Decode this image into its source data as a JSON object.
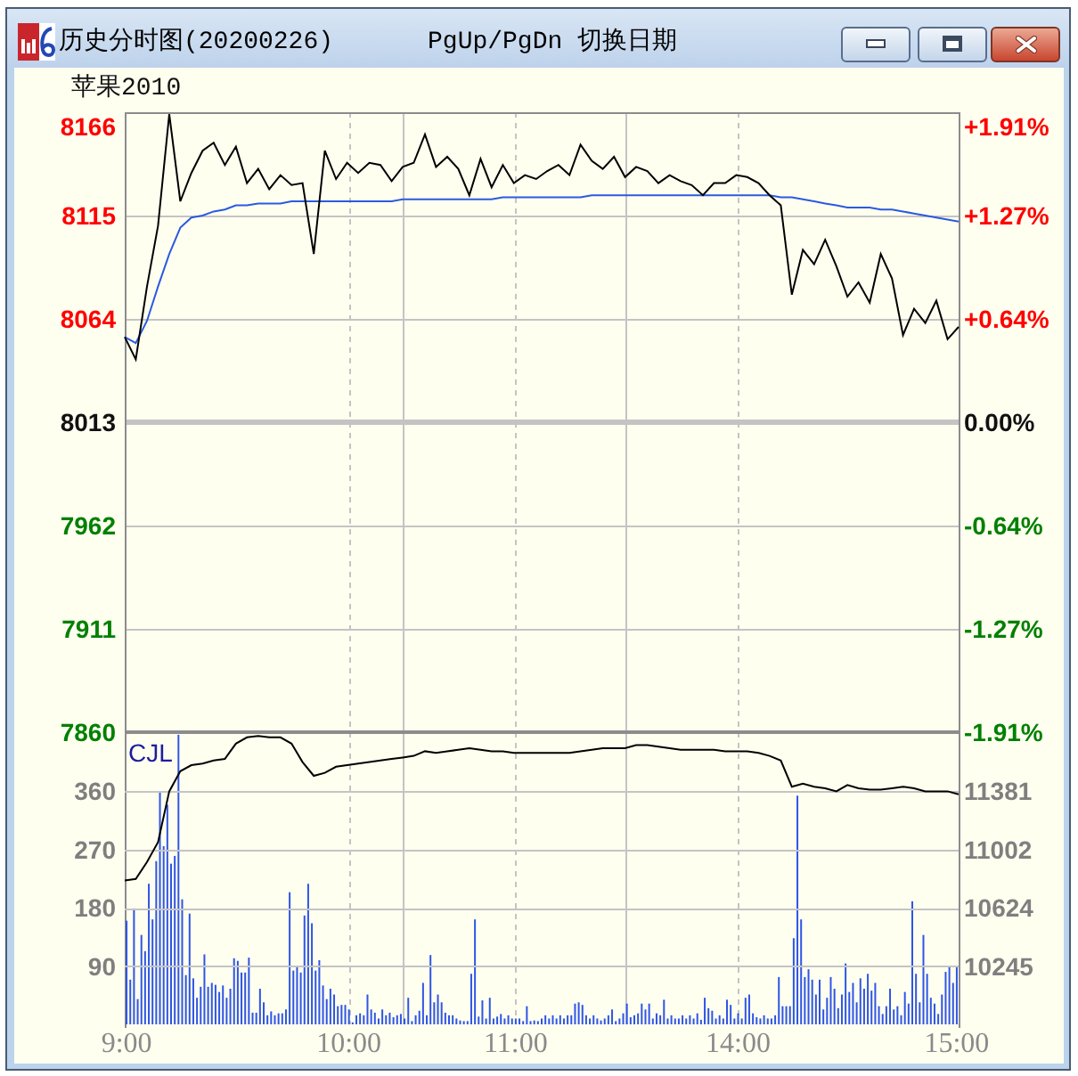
{
  "window": {
    "title": "历史分时图(20200226)",
    "shortcut_hint": "PgUp/PgDn 切换日期"
  },
  "instrument_label": "苹果2010",
  "price_chart": {
    "percent_labels": [
      {
        "label": "+1.91%",
        "color": "#ff0000"
      },
      {
        "label": "+1.27%",
        "color": "#ff0000"
      },
      {
        "label": "+0.64%",
        "color": "#ff0000"
      },
      {
        "label": "0.00%",
        "color": "#111111"
      },
      {
        "label": "-0.64%",
        "color": "#008000"
      },
      {
        "label": "-1.27%",
        "color": "#008000"
      },
      {
        "label": "-1.91%",
        "color": "#008000"
      }
    ],
    "chart_data": {
      "type": "line",
      "grid": true,
      "categories": [
        null,
        null,
        null,
        null,
        null,
        null,
        null,
        null,
        null,
        null,
        null,
        null,
        null,
        null,
        null,
        null,
        null,
        null,
        null,
        null,
        null,
        null,
        null,
        null,
        null,
        null,
        null,
        null,
        null,
        null,
        null,
        null,
        null,
        null,
        null,
        null,
        null,
        null,
        null,
        null,
        null,
        null,
        null,
        null,
        null,
        null,
        null,
        null,
        null,
        null,
        null,
        null,
        null,
        null,
        null,
        null,
        null,
        null,
        null,
        null,
        null,
        null,
        null,
        null,
        null,
        null,
        null,
        null,
        null,
        null,
        null,
        null,
        null,
        null,
        null,
        null
      ],
      "series": [
        {
          "color": "#000000",
          "values": [
            8055,
            8044,
            8080,
            8110,
            8165,
            8122,
            8136,
            8147,
            8151,
            8140,
            8149,
            8131,
            8138,
            8128,
            8135,
            8130,
            8131,
            8096,
            8147,
            8133,
            8141,
            8136,
            8141,
            8140,
            8132,
            8139,
            8141,
            8155,
            8139,
            8144,
            8138,
            8125,
            8143,
            8129,
            8140,
            8131,
            8135,
            8133,
            8137,
            8140,
            8135,
            8150,
            8142,
            8138,
            8144,
            8134,
            8139,
            8137,
            8131,
            8135,
            8132,
            8130,
            8125,
            8131,
            8131,
            8135,
            8134,
            8131,
            8125,
            8120,
            8076,
            8098,
            8091,
            8103,
            8090,
            8075,
            8082,
            8072,
            8096,
            8084,
            8056,
            8069,
            8062,
            8073,
            8054,
            8060
          ]
        },
        {
          "color": "#2a5ae0",
          "values": [
            8055,
            8052,
            8063,
            8080,
            8096,
            8109,
            8114,
            8115,
            8117,
            8118,
            8120,
            8120,
            8121,
            8121,
            8121,
            8122,
            8122,
            8122,
            8122,
            8122,
            8122,
            8122,
            8122,
            8122,
            8122,
            8123,
            8123,
            8123,
            8123,
            8123,
            8123,
            8123,
            8123,
            8123,
            8124,
            8124,
            8124,
            8124,
            8124,
            8124,
            8124,
            8124,
            8125,
            8125,
            8125,
            8125,
            8125,
            8125,
            8125,
            8125,
            8125,
            8125,
            8125,
            8125,
            8125,
            8125,
            8125,
            8125,
            8125,
            8124,
            8124,
            8123,
            8122,
            8121,
            8120,
            8119,
            8119,
            8119,
            8118,
            8118,
            8117,
            8116,
            8115,
            8114,
            8113,
            8112
          ]
        }
      ],
      "ylim": [
        7860,
        8166
      ],
      "yticks": [
        8166,
        8115,
        8064,
        8013,
        7962,
        7911,
        7860
      ],
      "ref_lines": [
        {
          "axis": "y",
          "value": 8013
        }
      ]
    }
  },
  "volume_chart": {
    "label": "CJL",
    "chart_data": {
      "type": "bar",
      "grid": true,
      "categories": [
        "9:00",
        null,
        null,
        null,
        null,
        null,
        null,
        null,
        null,
        null,
        null,
        null,
        null,
        null,
        null,
        null,
        null,
        null,
        null,
        null,
        null,
        null,
        null,
        null,
        null,
        null,
        null,
        null,
        null,
        null,
        null,
        null,
        null,
        null,
        null,
        null,
        null,
        null,
        null,
        null,
        null,
        null,
        null,
        null,
        null,
        null,
        null,
        null,
        null,
        null,
        null,
        null,
        null,
        null,
        null,
        null,
        null,
        null,
        null,
        null,
        "10:00",
        null,
        null,
        null,
        null,
        null,
        null,
        null,
        null,
        null,
        null,
        null,
        null,
        null,
        null,
        null,
        null,
        null,
        null,
        null,
        null,
        null,
        null,
        null,
        null,
        null,
        null,
        null,
        null,
        null,
        null,
        null,
        null,
        null,
        null,
        null,
        null,
        null,
        null,
        null,
        null,
        null,
        null,
        null,
        null,
        "11:00",
        null,
        null,
        null,
        null,
        null,
        null,
        null,
        null,
        null,
        null,
        null,
        null,
        null,
        null,
        null,
        null,
        null,
        null,
        null,
        null,
        null,
        null,
        null,
        null,
        null,
        null,
        null,
        null,
        null,
        null,
        null,
        null,
        null,
        null,
        null,
        null,
        null,
        null,
        null,
        null,
        null,
        null,
        null,
        null,
        null,
        null,
        null,
        null,
        null,
        null,
        null,
        null,
        null,
        null,
        null,
        null,
        null,
        null,
        null,
        "14:00",
        null,
        null,
        null,
        null,
        null,
        null,
        null,
        null,
        null,
        null,
        null,
        null,
        null,
        null,
        null,
        null,
        null,
        null,
        null,
        null,
        null,
        null,
        null,
        null,
        null,
        null,
        null,
        null,
        null,
        null,
        null,
        null,
        null,
        null,
        null,
        null,
        null,
        null,
        null,
        null,
        null,
        null,
        null,
        null,
        null,
        null,
        null,
        null,
        null,
        null,
        null,
        null,
        null,
        null,
        null,
        null,
        null,
        null,
        "15:00"
      ],
      "values": [
        160,
        69,
        179,
        39,
        138,
        113,
        217,
        162,
        252,
        360,
        275,
        339,
        248,
        260,
        447,
        193,
        76,
        171,
        71,
        41,
        58,
        108,
        58,
        64,
        61,
        50,
        60,
        41,
        55,
        102,
        98,
        80,
        80,
        103,
        18,
        18,
        55,
        34,
        14,
        20,
        14,
        17,
        17,
        23,
        204,
        83,
        89,
        80,
        168,
        217,
        156,
        83,
        99,
        60,
        39,
        55,
        46,
        28,
        30,
        30,
        23,
        3,
        14,
        17,
        14,
        46,
        23,
        18,
        9,
        23,
        14,
        18,
        11,
        14,
        16,
        9,
        41,
        5,
        14,
        21,
        64,
        14,
        107,
        34,
        46,
        34,
        18,
        14,
        14,
        9,
        6,
        5,
        5,
        78,
        162,
        12,
        37,
        9,
        41,
        9,
        12,
        16,
        9,
        14,
        9,
        9,
        9,
        5,
        28,
        5,
        6,
        5,
        9,
        14,
        9,
        14,
        9,
        14,
        9,
        14,
        14,
        32,
        34,
        30,
        14,
        9,
        14,
        9,
        6,
        9,
        14,
        23,
        5,
        9,
        17,
        32,
        11,
        14,
        17,
        32,
        23,
        32,
        9,
        17,
        14,
        38,
        9,
        14,
        9,
        9,
        14,
        9,
        14,
        9,
        17,
        7,
        41,
        25,
        21,
        9,
        14,
        9,
        38,
        30,
        9,
        17,
        9,
        41,
        46,
        17,
        11,
        9,
        14,
        9,
        9,
        14,
        73,
        28,
        28,
        28,
        133,
        353,
        162,
        73,
        85,
        69,
        46,
        69,
        23,
        41,
        73,
        55,
        25,
        46,
        94,
        50,
        64,
        34,
        71,
        55,
        78,
        52,
        64,
        28,
        16,
        28,
        55,
        23,
        28,
        14,
        50,
        32,
        190,
        78,
        34,
        138,
        78,
        41,
        32,
        16,
        46,
        81,
        90,
        64,
        90
      ],
      "ylim": [
        0,
        451
      ],
      "yticks": [
        90,
        180,
        270,
        360
      ]
    }
  },
  "overlay_line_chart": {
    "chart_data": {
      "type": "line",
      "grid": true,
      "categories": [
        null,
        null,
        null,
        null,
        null,
        null,
        null,
        null,
        null,
        null,
        null,
        null,
        null,
        null,
        null,
        null,
        null,
        null,
        null,
        null,
        null,
        null,
        null,
        null,
        null,
        null,
        null,
        null,
        null,
        null,
        null,
        null,
        null,
        null,
        null,
        null,
        null,
        null,
        null,
        null,
        null,
        null,
        null,
        null,
        null,
        null,
        null,
        null,
        null,
        null,
        null,
        null,
        null,
        null,
        null,
        null,
        null,
        null,
        null,
        null,
        null,
        null,
        null,
        null,
        null,
        null,
        null,
        null,
        null,
        null,
        null,
        null,
        null,
        null,
        null,
        null
      ],
      "values": [
        10800,
        10810,
        10920,
        11050,
        11380,
        11510,
        11550,
        11560,
        11580,
        11590,
        11690,
        11730,
        11740,
        11730,
        11730,
        11690,
        11570,
        11480,
        11500,
        11540,
        11550,
        11560,
        11570,
        11580,
        11590,
        11600,
        11610,
        11640,
        11630,
        11640,
        11650,
        11660,
        11650,
        11640,
        11640,
        11630,
        11630,
        11630,
        11630,
        11630,
        11630,
        11640,
        11650,
        11660,
        11660,
        11660,
        11680,
        11680,
        11670,
        11660,
        11650,
        11650,
        11650,
        11650,
        11640,
        11640,
        11640,
        11630,
        11610,
        11580,
        11410,
        11430,
        11410,
        11400,
        11380,
        11420,
        11400,
        11390,
        11390,
        11400,
        11410,
        11400,
        11380,
        11380,
        11380,
        11360
      ],
      "ylim": [
        9866,
        11764
      ],
      "yticks": [
        10245,
        10624,
        11002,
        11381
      ]
    }
  }
}
